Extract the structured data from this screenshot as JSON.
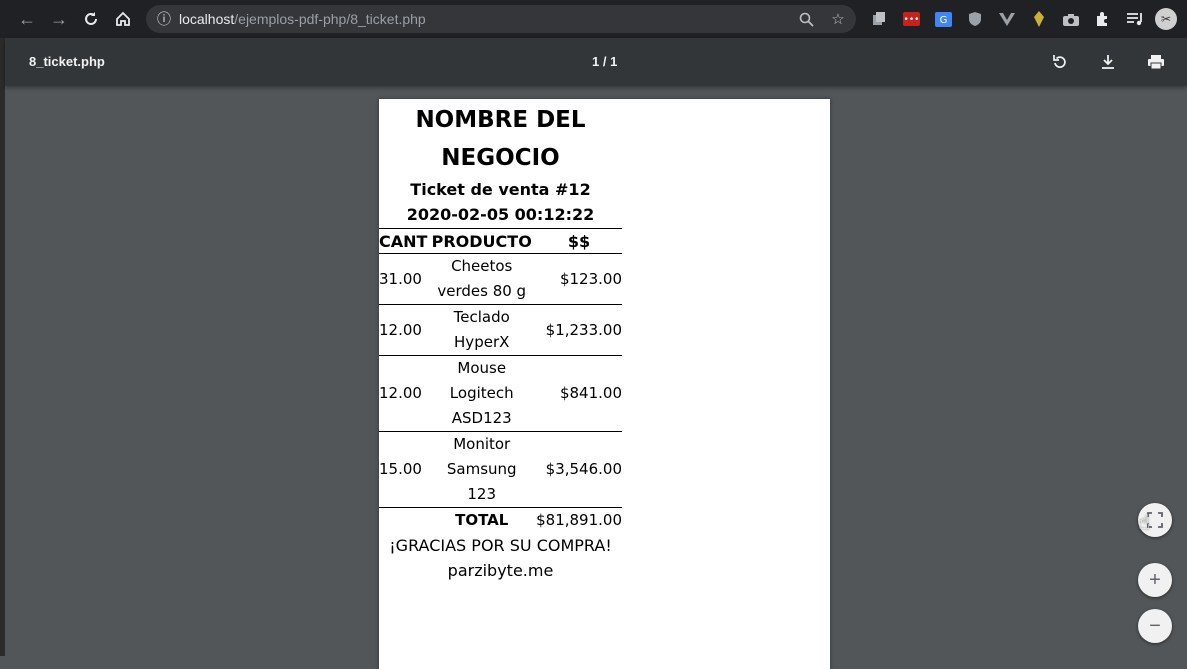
{
  "browser": {
    "url_host": "localhost",
    "url_path": "/ejemplos-pdf-php/8_ticket.php",
    "icons": {
      "back": "back-arrow-icon",
      "forward": "forward-arrow-icon",
      "reload": "reload-icon",
      "home": "home-icon",
      "info": "info-icon",
      "zoom": "zoom-icon",
      "star": "star-icon"
    },
    "extensions": [
      "copy-icon",
      "more-dots-extension-icon",
      "translate-icon",
      "ublock-icon",
      "vue-icon",
      "pin-icon",
      "camera-icon",
      "puzzle-icon",
      "media-queue-icon"
    ]
  },
  "viewer": {
    "title": "8_ticket.php",
    "page_indicator": "1 / 1",
    "buttons": {
      "rotate": "rotate-icon",
      "download": "download-icon",
      "print": "print-icon"
    }
  },
  "ticket": {
    "business_name_line1": "NOMBRE DEL",
    "business_name_line2": "NEGOCIO",
    "ticket_label": "Ticket de venta #12",
    "datetime": "2020-02-05 00:12:22",
    "headers": {
      "cant": "CANT",
      "producto": "PRODUCTO",
      "precio": "$$"
    },
    "items": [
      {
        "cant": "31.00",
        "producto": "Cheetos verdes 80 g",
        "precio": "$123.00"
      },
      {
        "cant": "12.00",
        "producto": "Teclado HyperX",
        "precio": "$1,233.00"
      },
      {
        "cant": "12.00",
        "producto": "Mouse Logitech ASD123",
        "precio": "$841.00"
      },
      {
        "cant": "15.00",
        "producto": "Monitor Samsung 123",
        "precio": "$3,546.00"
      }
    ],
    "total_label": "TOTAL",
    "total_value": "$81,891.00",
    "thanks": "¡GRACIAS POR SU COMPRA!",
    "website": "parzibyte.me"
  },
  "zoom": {
    "fit": "fit-page-icon",
    "zoom_in": "+",
    "zoom_out": "−"
  }
}
